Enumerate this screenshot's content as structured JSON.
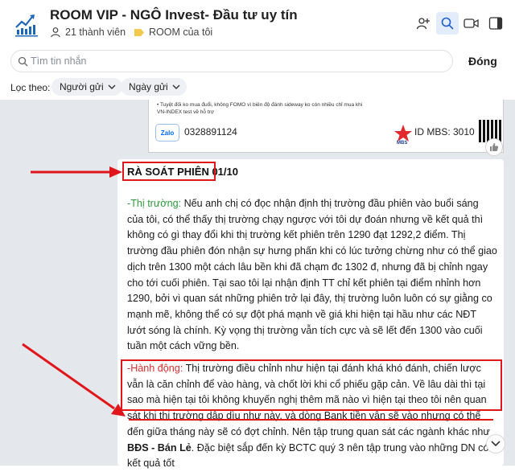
{
  "header": {
    "title": "ROOM VIP - NGÔ Invest- Đầu tư uy tín",
    "members": "21 thành viên",
    "room_label": "ROOM của tôi"
  },
  "search": {
    "placeholder": "Tìm tin nhắn",
    "close_label": "Đóng"
  },
  "filters": {
    "label": "Lọc theo:",
    "sender": "Người gửi",
    "date": "Ngày gửi"
  },
  "image_card": {
    "text_line1": "• Tuyệt đối ko mua đuổi, không FOMO vì biên độ đánh sideway ko còn nhiều chỉ mua khi",
    "text_line2": "VN-INDEX test về hỗ trợ",
    "zalo_label": "Zalo",
    "phone": "0328891124",
    "mbs_label": "MBS",
    "id_mbs": "ID MBS: 3010"
  },
  "message": {
    "heading": "RÀ SOÁT PHIÊN 01/10",
    "market_label": "-Thị trường:",
    "market_text": " Nếu anh chị có đọc nhận định thị trường đầu phiên vào buổi sáng của tôi, có thể thấy thị trường chạy ngược với tôi dự đoán nhưng về kết quả thì không có gì thay đổi khi thị trường kết phiên trên 1290 đạt 1292,2 điểm. Thị trường đầu phiên đón nhận sự hưng phấn khi có lúc tưởng chừng như có thể giao dịch trên 1300 một cách lâu bền khi đã chạm đc 1302 đ, nhưng đã bị chỉnh ngay cho tới cuối phiên. Tại sao tôi lại nhận định TT chỉ kết phiên tại điểm nhỉnh hơn 1290, bởi vì quan sát những phiên trở lại đây, thị trường luôn luôn có sự giằng co mạnh mẽ, không thể có sự đột phá mạnh về giá khi hiện tại hầu như các NĐT lướt sóng là chính. Kỳ vọng thị trường vẫn tích cực và sẽ lết đến 1300 vào cuối tuần một cách vững bền.",
    "action_label": "-Hành động:",
    "action_text": "  Thị trường điều chỉnh như hiện tại đánh khá khó đánh, chiến lược vẫn là căn chỉnh để vào hàng, và chốt lời khi cổ phiếu gặp cản. Về lâu dài thì tại sao mà hiện tại tôi không khuyến nghị thêm mã nào vì hiện tại theo tôi nên quan sát khi thị trường dập dìu như này, và dòng Bank tiền vẫn sẽ vào nhưng có thể đến giữa tháng này sẽ có đợt chỉnh. Nên tập trung quan sát các ngành khác như ",
    "action_bold": "BĐS - Bán Lẻ",
    "action_tail": ". Đặc biệt sắp đến kỳ BCTC quý 3 nên tập trung vào những DN có kết quả tốt"
  },
  "colors": {
    "accent": "#0068ff",
    "annotation_red": "#e0161b",
    "label_green": "#2e9a3c",
    "label_red": "#d62e2e"
  }
}
